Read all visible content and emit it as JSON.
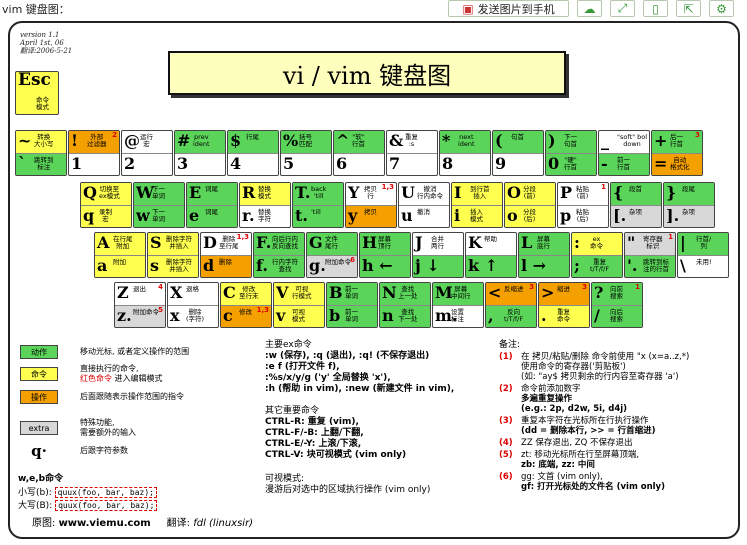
{
  "page_title": "vim 键盘图：",
  "toolbar": {
    "send_label": "发送图片到手机",
    "icons": [
      "send-image-icon",
      "cloud-icon",
      "fullscreen-icon",
      "save-icon",
      "share-icon",
      "gear-icon"
    ]
  },
  "version": [
    "version 1.1",
    "April 1st, 06",
    "翻译:2006-5-21"
  ],
  "title": "vi / vim 键盘图",
  "esc": {
    "key": "Esc",
    "desc": "命令\n模式"
  },
  "num_row": [
    {
      "top": "~",
      "top_d": "转换\n大小写",
      "bot": "`",
      "bot_d": "跳转到\n标注",
      "c": "y",
      "bc": "g"
    },
    {
      "top": "!",
      "top_d": "外部\n过滤器",
      "bot": "1",
      "bot_d": "",
      "c": "o",
      "bc": "w",
      "sup": "2"
    },
    {
      "top": "@",
      "top_d": "运行\n宏",
      "bot": "2",
      "bot_d": "",
      "c": "w",
      "bc": "w"
    },
    {
      "top": "#",
      "top_d": "prev\nident",
      "bot": "3",
      "bot_d": "",
      "c": "g",
      "bc": "w"
    },
    {
      "top": "$",
      "top_d": "行尾",
      "bot": "4",
      "bot_d": "",
      "c": "g",
      "bc": "w"
    },
    {
      "top": "%",
      "top_d": "括号\n匹配",
      "bot": "5",
      "bot_d": "",
      "c": "g",
      "bc": "w"
    },
    {
      "top": "^",
      "top_d": "\"软\"\n行首",
      "bot": "6",
      "bot_d": "",
      "c": "g",
      "bc": "w"
    },
    {
      "top": "&",
      "top_d": "重复\n:s",
      "bot": "7",
      "bot_d": "",
      "c": "w",
      "bc": "w"
    },
    {
      "top": "*",
      "top_d": "next\nident",
      "bot": "8",
      "bot_d": "",
      "c": "g",
      "bc": "w"
    },
    {
      "top": "(",
      "top_d": "句首",
      "bot": "9",
      "bot_d": "",
      "c": "g",
      "bc": "w"
    },
    {
      "top": ")",
      "top_d": "下一\n句首",
      "bot": "0",
      "bot_d": "\"硬\"\n行首",
      "c": "g",
      "bc": "g"
    },
    {
      "top": "_",
      "top_d": "\"soft\" bol\ndown",
      "bot": "-",
      "bot_d": "前一\n行首",
      "c": "w",
      "bc": "g"
    },
    {
      "top": "+",
      "top_d": "后一\n行首",
      "bot": "=",
      "bot_d": "自动\n格式化",
      "c": "g",
      "bc": "o",
      "sup": "3"
    }
  ],
  "q_row": [
    {
      "top": "Q",
      "top_d": "切换至\nex模式",
      "bot": "q",
      "bot_d": "录制\n宏",
      "c": "y",
      "bc": "y"
    },
    {
      "top": "W",
      "top_d": "下一\n单词",
      "bot": "w",
      "bot_d": "下一\n单词",
      "c": "g",
      "bc": "g"
    },
    {
      "top": "E",
      "top_d": "词尾",
      "bot": "e",
      "bot_d": "词尾",
      "c": "g",
      "bc": "g"
    },
    {
      "top": "R",
      "top_d": "替换\n模式",
      "bot": "r.",
      "bot_d": "替换\n字符",
      "c": "y",
      "bc": "w"
    },
    {
      "top": "T.",
      "top_d": "back\n'till",
      "bot": "t.",
      "bot_d": "'till",
      "c": "g",
      "bc": "g"
    },
    {
      "top": "Y",
      "top_d": "拷贝\n行",
      "bot": "y",
      "bot_d": "拷贝",
      "c": "w",
      "bc": "o",
      "sup": "1,3"
    },
    {
      "top": "U",
      "top_d": "撤消\n行内命令",
      "bot": "u",
      "bot_d": "撤消",
      "c": "w",
      "bc": "w"
    },
    {
      "top": "I",
      "top_d": "到行首\n插入",
      "bot": "i",
      "bot_d": "插入\n模式",
      "c": "y",
      "bc": "y"
    },
    {
      "top": "O",
      "top_d": "分段\n(前)",
      "bot": "o",
      "bot_d": "分段\n(后)",
      "c": "y",
      "bc": "y"
    },
    {
      "top": "P",
      "top_d": "粘贴\n(前)",
      "bot": "p",
      "bot_d": "粘贴\n(后)",
      "c": "w",
      "bc": "w",
      "sup": "1"
    },
    {
      "top": "{",
      "top_d": "段首",
      "bot": "[.",
      "bot_d": "杂项",
      "c": "g",
      "bc": "gr"
    },
    {
      "top": "}",
      "top_d": "段尾",
      "bot": "].",
      "bot_d": "杂项",
      "c": "g",
      "bc": "gr"
    }
  ],
  "a_row": [
    {
      "top": "A",
      "top_d": "在行尾\n附加",
      "bot": "a",
      "bot_d": "附加",
      "c": "y",
      "bc": "y"
    },
    {
      "top": "S",
      "top_d": "删除字符\n并插入",
      "bot": "s",
      "bot_d": "删除字符\n并插入",
      "c": "y",
      "bc": "y"
    },
    {
      "top": "D",
      "top_d": "删除\n至行尾",
      "bot": "d",
      "bot_d": "删除",
      "c": "w",
      "bc": "o",
      "sup": "1,3"
    },
    {
      "top": "F.",
      "top_d": "向后行内\n反向查找",
      "bot": "f.",
      "bot_d": "行内字符\n查找",
      "c": "g",
      "bc": "g"
    },
    {
      "top": "G",
      "top_d": "文件\n尾行",
      "bot": "g.",
      "bot_d": "附加命令",
      "c": "g",
      "bc": "gr",
      "sup2": "6"
    },
    {
      "top": "H",
      "top_d": "屏幕\n顶行",
      "bot": "h ←",
      "bot_d": "",
      "c": "g",
      "bc": "g"
    },
    {
      "top": "J",
      "top_d": "合并\n两行",
      "bot": "j ↓",
      "bot_d": "",
      "c": "w",
      "bc": "g"
    },
    {
      "top": "K",
      "top_d": "帮助",
      "bot": "k ↑",
      "bot_d": "",
      "c": "w",
      "bc": "g"
    },
    {
      "top": "L",
      "top_d": "屏幕\n底行",
      "bot": "l →",
      "bot_d": "",
      "c": "g",
      "bc": "g"
    },
    {
      "top": ":",
      "top_d": "ex\n命令",
      "bot": ";",
      "bot_d": "重复\nt/T/f/F",
      "c": "y",
      "bc": "g"
    },
    {
      "top": "\"",
      "top_d": "寄存器\n标识",
      "bot": "'.",
      "bot_d": "跳转到标\n注的行首",
      "c": "gr",
      "bc": "g",
      "sup": "1"
    },
    {
      "top": "|",
      "top_d": "行首/\n列",
      "bot": "\\",
      "bot_d": "未用!",
      "c": "g",
      "bc": "w"
    }
  ],
  "z_row": [
    {
      "top": "Z",
      "top_d": "退出",
      "bot": "z.",
      "bot_d": "附加命令",
      "c": "w",
      "bc": "gr",
      "sup": "4",
      "sup2": "5"
    },
    {
      "top": "X",
      "top_d": "退格",
      "bot": "x",
      "bot_d": "删除\n(字符)",
      "c": "w",
      "bc": "w"
    },
    {
      "top": "C",
      "top_d": "修改\n至行末",
      "bot": "c",
      "bot_d": "修改",
      "c": "y",
      "bc": "o",
      "sup2": "1,3"
    },
    {
      "top": "V",
      "top_d": "可视\n行模式",
      "bot": "v",
      "bot_d": "可视\n模式",
      "c": "y",
      "bc": "y"
    },
    {
      "top": "B",
      "top_d": "前一\n单词",
      "bot": "b",
      "bot_d": "前一\n单词",
      "c": "g",
      "bc": "g"
    },
    {
      "top": "N",
      "top_d": "查找\n上一处",
      "bot": "n",
      "bot_d": "查找\n下一处",
      "c": "g",
      "bc": "g"
    },
    {
      "top": "M",
      "top_d": "屏幕\n中间行",
      "bot": "m.",
      "bot_d": "设置\n标注",
      "c": "g",
      "bc": "w"
    },
    {
      "top": "<",
      "top_d": "反缩进",
      "bot": ",",
      "bot_d": "反向\nt/T/f/F",
      "c": "o",
      "bc": "g",
      "sup": "3"
    },
    {
      "top": ">",
      "top_d": "缩进",
      "bot": ".",
      "bot_d": "重复\n命令",
      "c": "o",
      "bc": "y",
      "sup": "3"
    },
    {
      "top": "?",
      "top_d": "向前\n搜索",
      "bot": "/",
      "bot_d": "向后\n搜索",
      "c": "g",
      "bc": "g",
      "sup": "1"
    }
  ],
  "legend": [
    {
      "sw": "动作",
      "c": "g",
      "text": "移动光标, 或者定义操作的范围"
    },
    {
      "sw": "命令",
      "c": "y",
      "text": "直接执行的命令,",
      "text2": "红色命令",
      "text3": " 进入编辑模式"
    },
    {
      "sw": "操作",
      "c": "o",
      "text": "后面跟随表示操作范围的指令"
    },
    {
      "sw": "extra",
      "c": "gr",
      "text": "特殊功能,",
      "text4": "需要额外的输入"
    },
    {
      "sw": "q·",
      "c": "w",
      "text": "后跟字符参数"
    }
  ],
  "wbe": {
    "title": "w,e,b命令",
    "small_label": "小写(b):",
    "small_val": "quux(foo, bar, baz);",
    "big_label": "大写(B):",
    "big_val": "quux(foo, bar, baz);"
  },
  "credits": {
    "orig_label": "原图:",
    "orig": "www.viemu.com",
    "trans_label": "翻译:",
    "trans": "fdl (linuxsir)"
  },
  "ex": {
    "title": "主要ex命令",
    "lines": [
      ":w (保存), :q (退出), :q! (不保存退出)",
      ":e f (打开文件 f),",
      ":%s/x/y/g ('y' 全局替换 'x'),",
      ":h (帮助 in vim), :new (新建文件 in vim),"
    ]
  },
  "other": {
    "title": "其它重要命令",
    "lines": [
      "CTRL-R: 重复 (vim),",
      "CTRL-F/-B: 上翻/下翻,",
      "CTRL-E/-Y: 上滚/下滚,",
      "CTRL-V: 块可视模式 (vim only)"
    ]
  },
  "visual": {
    "title": "可视模式:",
    "line": "漫游后对选中的区域执行操作 (vim only)"
  },
  "notes": {
    "title": "备注:",
    "items": [
      {
        "n": "(1)",
        "lines": [
          "在 拷贝/粘贴/删除 命令前使用 \"x (x=a..z,*)",
          "使用命令的寄存器('剪贴板')",
          "(如: \"ay$ 拷贝剩余的行内容至寄存器 'a')"
        ]
      },
      {
        "n": "(2)",
        "lines": [
          "命令前添加数字",
          "多遍重复操作",
          "(e.g.: 2p, d2w, 5i, d4j)"
        ]
      },
      {
        "n": "(3)",
        "lines": [
          "重复本字符在光标所在行执行操作",
          "(dd = 删除本行, >> = 行首缩进)"
        ]
      },
      {
        "n": "(4)",
        "lines": [
          "ZZ 保存退出, ZQ 不保存退出"
        ]
      },
      {
        "n": "(5)",
        "lines": [
          "zt: 移动光标所在行至屏幕顶端,",
          "zb: 底端, zz: 中间"
        ]
      },
      {
        "n": "(6)",
        "lines": [
          "gg: 文首 (vim only),",
          "gf: 打开光标处的文件名 (vim only)"
        ]
      }
    ]
  }
}
